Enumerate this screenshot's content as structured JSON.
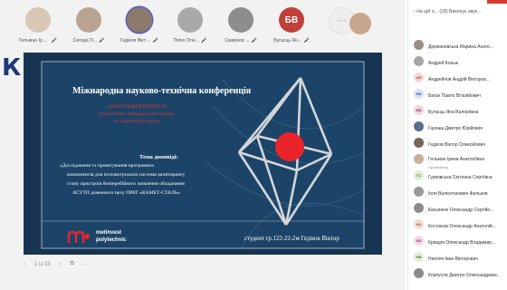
{
  "participants": [
    {
      "name": "Гельман Ірина ...",
      "initials": "",
      "color": "#d9c7b6"
    },
    {
      "name": "Сегеда П...",
      "initials": "",
      "color": "#b9a491"
    },
    {
      "name": "Гедіков Віктор ...",
      "initials": "",
      "color": "#8c7a6b"
    },
    {
      "name": "Піпко Оле...",
      "initials": "",
      "color": "#a9a9a9"
    },
    {
      "name": "Смирнов ...",
      "initials": "",
      "color": "#8d8d8d"
    },
    {
      "name": "Бугаєць Ян...",
      "initials": "БВ",
      "color": "#c0403a"
    },
    {
      "name": "",
      "initials": "···",
      "color": "#eeeeee"
    }
  ],
  "side_letter": "К",
  "slide": {
    "title": "Міжнародна науково-технічна конференція",
    "red_lines": [
      "«ЕНЕРГОЕФЕКТИВНІСТЬ",
      "Технологічні інновації в металургії",
      "та машинобудуванні»"
    ],
    "topic_label": "Тема доповіді:",
    "topic_lines": [
      "«Дослідження та проектування програмних",
      "компонентів для інтелектуальної системи моніторингу",
      "стану пристроїв безперебійного живлення обладнання",
      "АСУТП доменного цеху ПРАТ «КАМЕТ-СТАЛЬ»"
    ],
    "logo_line1": "metinvest",
    "logo_line2": "polytechnic",
    "student": "студент гр.122-22-2м    Гедіков Віктор"
  },
  "bottom": {
    "prev": "‹",
    "page": "1 із 13",
    "next": "›",
    "copy": "⧉",
    "more": "···"
  },
  "panel": {
    "header": "‹  На цій н...  (28)  Виконує звук...",
    "people": [
      {
        "name": "Держаневська Марина Анато...",
        "initials": "",
        "bg": "#9a8c7f",
        "fg": "#fff"
      },
      {
        "name": "Андрей Конык",
        "initials": "",
        "bg": "#a6a6a6",
        "fg": "#fff"
      },
      {
        "name": "Андрейчов Андрій Вікторов...",
        "initials": "АВ",
        "bg": "#f5d9d2",
        "fg": "#b94a3a"
      },
      {
        "name": "Баган Павло Віталійович",
        "initials": "БВ",
        "bg": "#d8e3f5",
        "fg": "#3b5ba8"
      },
      {
        "name": "Бугаєць Яна Валеріївна",
        "initials": "БВ",
        "bg": "#f5d3e2",
        "fg": "#a03a6b"
      },
      {
        "name": "Гарчаш Дмитро Юрійович",
        "initials": "",
        "bg": "#5a6f8e",
        "fg": "#fff"
      },
      {
        "name": "Гедіков Віктор Олексійович",
        "initials": "",
        "bg": "#7a6656",
        "fg": "#fff"
      },
      {
        "name": "Гельман Ірина Анатоліївна",
        "role": "Організатор",
        "initials": "",
        "bg": "#c9b09a",
        "fg": "#fff"
      },
      {
        "name": "Гурковська Світлана Сергіївна",
        "initials": "ГС",
        "bg": "#dcefd6",
        "fg": "#4a7a3a"
      },
      {
        "name": "Іоля Валентинович Фальков",
        "initials": "",
        "bg": "#9a9a9a",
        "fg": "#fff"
      },
      {
        "name": "Касьянюк Олександр Сергійо...",
        "initials": "",
        "bg": "#8d8d8d",
        "fg": "#fff"
      },
      {
        "name": "Костюков Олександр Анатолій...",
        "initials": "КА",
        "bg": "#f5dcd5",
        "fg": "#b04a3a"
      },
      {
        "name": "Крищов Олександр Владимир...",
        "initials": "КВ",
        "bg": "#f5d6e6",
        "fg": "#a0407a"
      },
      {
        "name": "Напоян Іван Вікторович",
        "initials": "НВ",
        "bg": "#dcefd6",
        "fg": "#4a7a3a"
      },
      {
        "name": "Корпусов Дмитро Олександрови...",
        "initials": "",
        "bg": "#8a8a8a",
        "fg": "#fff"
      }
    ]
  }
}
